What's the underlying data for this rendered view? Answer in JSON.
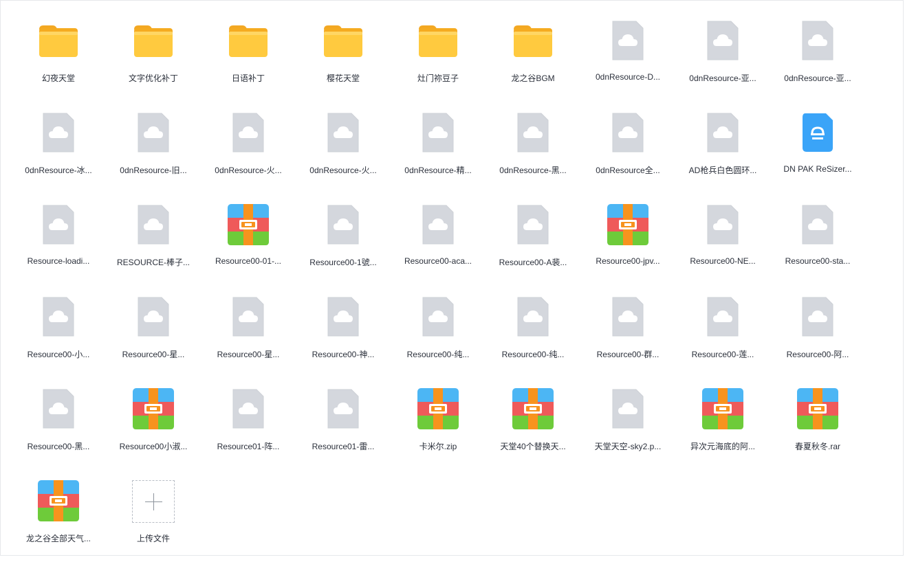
{
  "files": [
    {
      "name": "幻夜天堂",
      "icon": "folder-icon"
    },
    {
      "name": "文字优化补丁",
      "icon": "folder-icon"
    },
    {
      "name": "日语补丁",
      "icon": "folder-icon"
    },
    {
      "name": "樱花天堂",
      "icon": "folder-icon"
    },
    {
      "name": "灶门祢豆子",
      "icon": "folder-icon"
    },
    {
      "name": "龙之谷BGM",
      "icon": "folder-icon"
    },
    {
      "name": "0dnResource-D...",
      "icon": "cloud-file-icon"
    },
    {
      "name": "0dnResource-亚...",
      "icon": "cloud-file-icon"
    },
    {
      "name": "0dnResource-亚...",
      "icon": "cloud-file-icon"
    },
    {
      "name": "0dnResource-冰...",
      "icon": "cloud-file-icon"
    },
    {
      "name": "0dnResource-旧...",
      "icon": "cloud-file-icon"
    },
    {
      "name": "0dnResource-火...",
      "icon": "cloud-file-icon"
    },
    {
      "name": "0dnResource-火...",
      "icon": "cloud-file-icon"
    },
    {
      "name": "0dnResource-精...",
      "icon": "cloud-file-icon"
    },
    {
      "name": "0dnResource-黑...",
      "icon": "cloud-file-icon"
    },
    {
      "name": "0dnResource全...",
      "icon": "cloud-file-icon"
    },
    {
      "name": "AD枪兵白色圆环...",
      "icon": "cloud-file-icon"
    },
    {
      "name": "DN PAK ReSizer...",
      "icon": "app-file-icon"
    },
    {
      "name": "Resource-loadi...",
      "icon": "cloud-file-icon"
    },
    {
      "name": "RESOURCE-棒子...",
      "icon": "cloud-file-icon"
    },
    {
      "name": "Resource00-01-...",
      "icon": "archive-icon"
    },
    {
      "name": "Resource00-1號...",
      "icon": "cloud-file-icon"
    },
    {
      "name": "Resource00-aca...",
      "icon": "cloud-file-icon"
    },
    {
      "name": "Resource00-A裴...",
      "icon": "cloud-file-icon"
    },
    {
      "name": "Resource00-jpv...",
      "icon": "archive-icon"
    },
    {
      "name": "Resource00-NE...",
      "icon": "cloud-file-icon"
    },
    {
      "name": "Resource00-sta...",
      "icon": "cloud-file-icon"
    },
    {
      "name": "Resource00-小...",
      "icon": "cloud-file-icon"
    },
    {
      "name": "Resource00-星...",
      "icon": "cloud-file-icon"
    },
    {
      "name": "Resource00-星...",
      "icon": "cloud-file-icon"
    },
    {
      "name": "Resource00-神...",
      "icon": "cloud-file-icon"
    },
    {
      "name": "Resource00-纯...",
      "icon": "cloud-file-icon"
    },
    {
      "name": "Resource00-纯...",
      "icon": "cloud-file-icon"
    },
    {
      "name": "Resource00-群...",
      "icon": "cloud-file-icon"
    },
    {
      "name": "Resource00-莲...",
      "icon": "cloud-file-icon"
    },
    {
      "name": "Resource00-阿...",
      "icon": "cloud-file-icon"
    },
    {
      "name": "Resource00-黑...",
      "icon": "cloud-file-icon"
    },
    {
      "name": "Resource00小淑...",
      "icon": "archive-icon"
    },
    {
      "name": "Resource01-阵...",
      "icon": "cloud-file-icon"
    },
    {
      "name": "Resource01-雷...",
      "icon": "cloud-file-icon"
    },
    {
      "name": "卡米尔.zip",
      "icon": "archive-icon"
    },
    {
      "name": "天堂40个替换天...",
      "icon": "archive-icon"
    },
    {
      "name": "天堂天空-sky2.p...",
      "icon": "cloud-file-icon"
    },
    {
      "name": "异次元海底的阿...",
      "icon": "archive-icon"
    },
    {
      "name": "春夏秋冬.rar",
      "icon": "archive-icon"
    },
    {
      "name": "龙之谷全部天气...",
      "icon": "archive-icon"
    }
  ],
  "upload": {
    "label": "上传文件",
    "icon": "plus-icon"
  },
  "colors": {
    "folder": "#ffc53d",
    "cloud_file": "#d3d6dc",
    "app_file": "#3da2f7",
    "text": "#2a2f3a"
  }
}
